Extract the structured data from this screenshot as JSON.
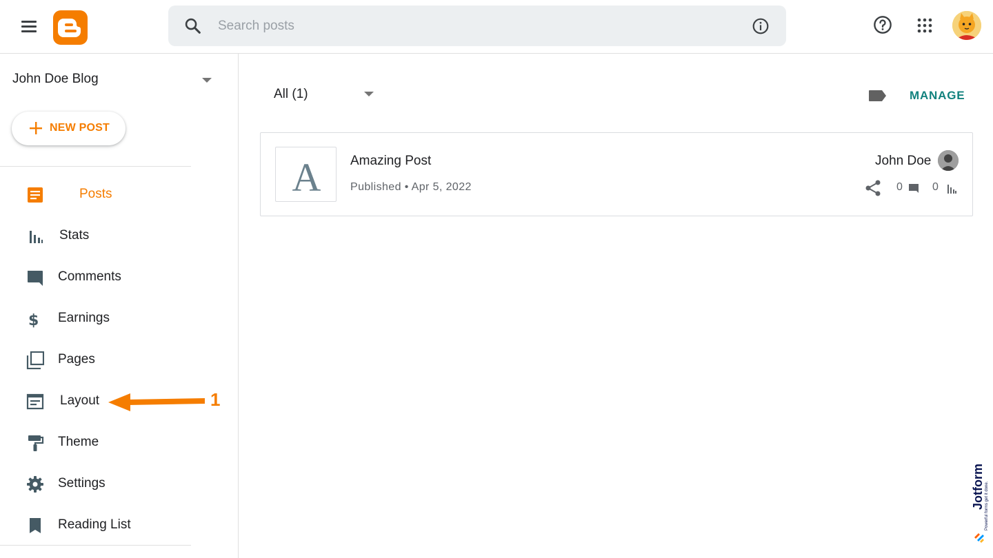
{
  "search": {
    "placeholder": "Search posts"
  },
  "sidebar": {
    "blog_name": "John Doe Blog",
    "new_post_label": "NEW POST",
    "items": [
      {
        "label": "Posts",
        "icon": "posts-icon"
      },
      {
        "label": "Stats",
        "icon": "stats-icon"
      },
      {
        "label": "Comments",
        "icon": "comments-icon"
      },
      {
        "label": "Earnings",
        "icon": "dollar-icon"
      },
      {
        "label": "Pages",
        "icon": "pages-icon"
      },
      {
        "label": "Layout",
        "icon": "layout-icon"
      },
      {
        "label": "Theme",
        "icon": "paint-roller-icon"
      },
      {
        "label": "Settings",
        "icon": "gear-icon"
      },
      {
        "label": "Reading List",
        "icon": "bookmark-icon"
      }
    ],
    "active_item": "Posts"
  },
  "annotation": {
    "step_number": "1",
    "color": "#f57d00"
  },
  "main": {
    "filter_label": "All (1)",
    "manage_label": "MANAGE",
    "posts": [
      {
        "thumb_letter": "A",
        "title": "Amazing Post",
        "meta": "Published • Apr 5, 2022",
        "author": "John Doe",
        "comments_count": "0",
        "views_count": "0"
      }
    ]
  },
  "watermark": {
    "brand": "Jotform",
    "tagline": "Powerful forms get it done."
  },
  "colors": {
    "accent": "#f57d00",
    "manage": "#12827e",
    "icon": "#455a64"
  }
}
